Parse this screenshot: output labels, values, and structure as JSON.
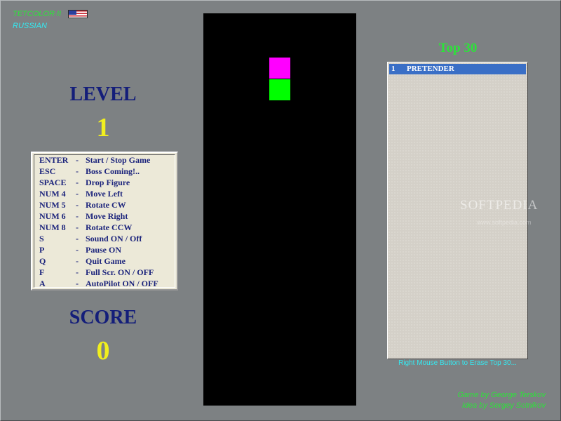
{
  "app": {
    "title": "TETCOLOR II",
    "flag_icon": "us-flag-icon",
    "language_option": "RUSSIAN"
  },
  "level": {
    "label": "LEVEL",
    "value": "1"
  },
  "score": {
    "label": "SCORE",
    "value": "0"
  },
  "controls": [
    {
      "key": "ENTER",
      "dash": "-",
      "action": "Start / Stop  Game"
    },
    {
      "key": "ESC",
      "dash": "-",
      "action": "Boss  Coming!.."
    },
    {
      "key": "SPACE",
      "dash": "-",
      "action": "Drop  Figure"
    },
    {
      "key": "NUM 4",
      "dash": "-",
      "action": "Move  Left"
    },
    {
      "key": "NUM 5",
      "dash": "-",
      "action": "Rotate  CW"
    },
    {
      "key": "NUM 6",
      "dash": "-",
      "action": "Move  Right"
    },
    {
      "key": "NUM 8",
      "dash": "-",
      "action": "Rotate  CCW"
    },
    {
      "key": "S",
      "dash": "-",
      "action": "Sound  ON / Off"
    },
    {
      "key": "P",
      "dash": "-",
      "action": "Pause  ON"
    },
    {
      "key": "Q",
      "dash": "-",
      "action": "Quit  Game"
    },
    {
      "key": "F",
      "dash": "-",
      "action": "Full  Scr.  ON / OFF"
    },
    {
      "key": "A",
      "dash": "-",
      "action": "AutoPilot  ON / OFF"
    }
  ],
  "board": {
    "falling_piece_colors": [
      "#ff00ff",
      "#00ff00"
    ]
  },
  "top30": {
    "title": "Top 30",
    "entries": [
      {
        "rank": "1",
        "name": "PRETENDER"
      }
    ],
    "hint": "Right Mouse Button to Erase Top 30..."
  },
  "watermark": {
    "text": "SOFTPEDIA",
    "sub": "www.softpedia.com"
  },
  "credits": {
    "game_by": "Game by George Terskov",
    "idea_by": "Idea by Sergey Sotnikov"
  },
  "colors": {
    "background": "#7d8183",
    "label_blue": "#141e7a",
    "value_yellow": "#f1ef1e",
    "accent_green": "#2de23a",
    "accent_cyan": "#35e8f0"
  }
}
